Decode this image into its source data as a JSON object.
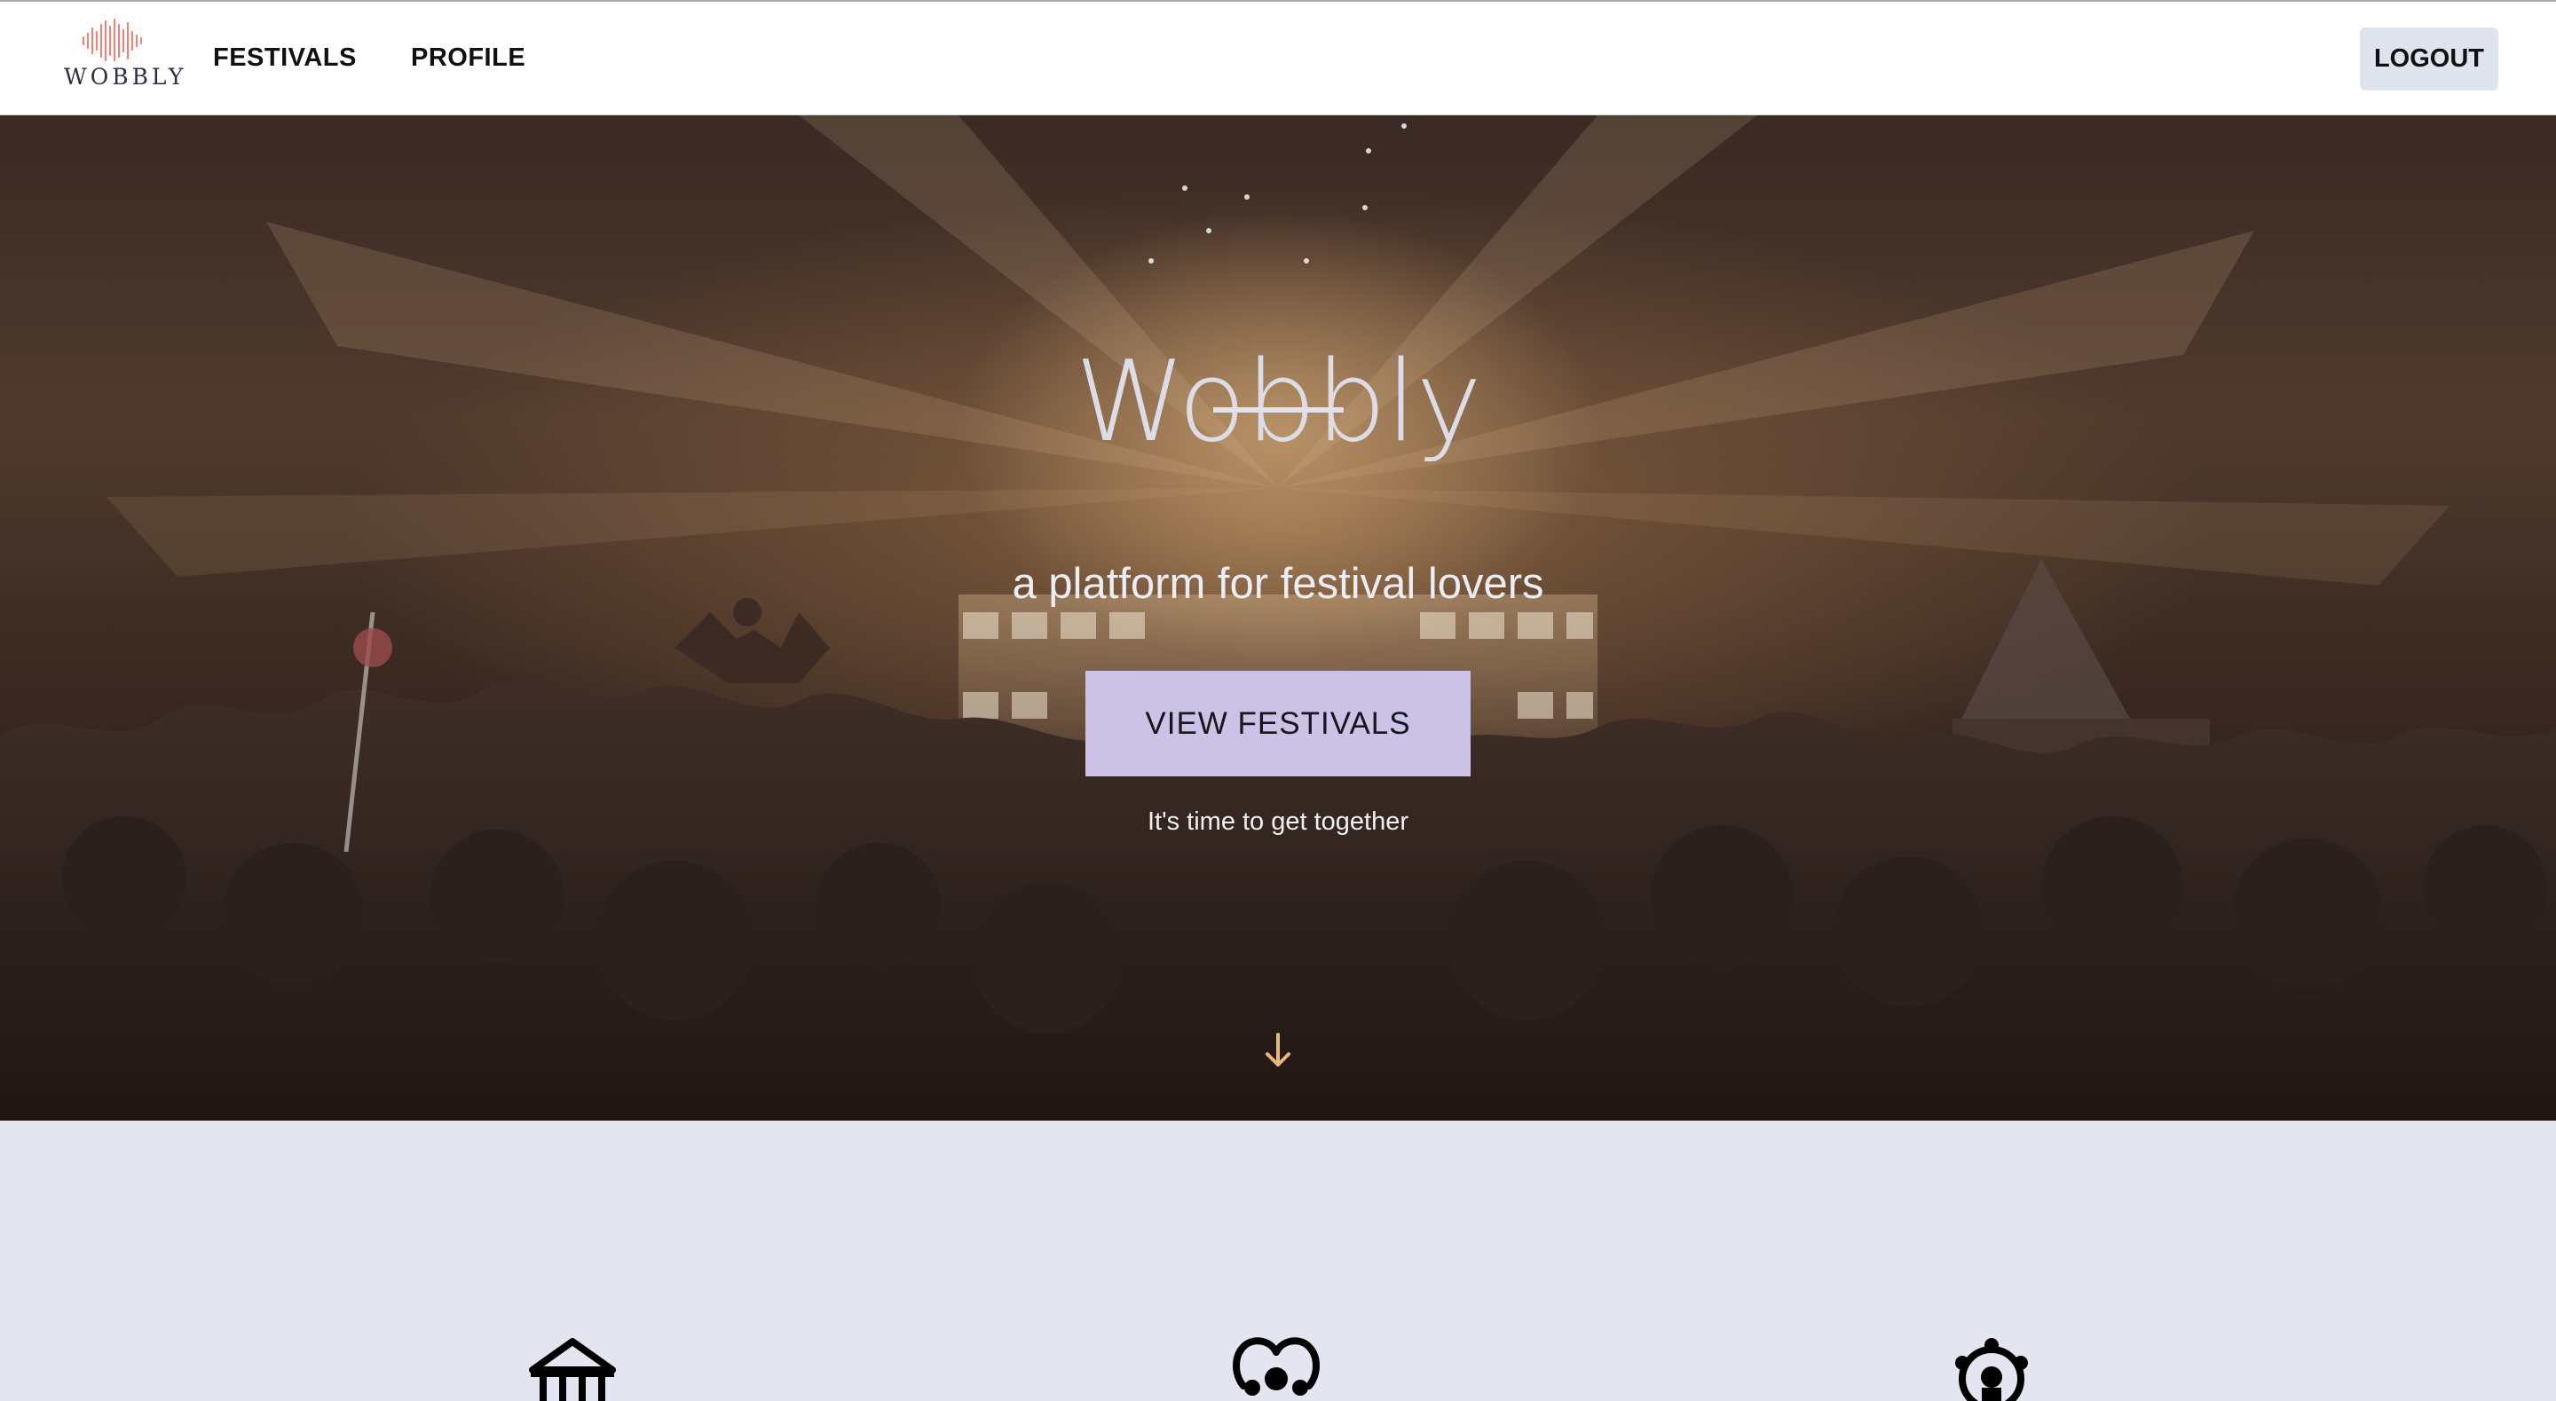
{
  "navbar": {
    "logo_text": "WOBBLY",
    "links": [
      {
        "label": "FESTIVALS"
      },
      {
        "label": "PROFILE"
      }
    ],
    "logout_label": "LOGOUT"
  },
  "hero": {
    "title": "Wobbly",
    "tagline": "a platform for festival lovers",
    "cta_label": "VIEW FESTIVALS",
    "subtext": "It's time to get together",
    "scroll_icon": "arrow-down-icon"
  },
  "features": {
    "icons": [
      "carousel-icon",
      "group-heart-icon",
      "ferris-wheel-icon"
    ]
  },
  "colors": {
    "nav_bg": "#ffffff",
    "logout_bg": "#dfe3ee",
    "cta_bg": "#ccc2e5",
    "feature_bg": "#e3e6f1",
    "logo_accent": "#e08a7d",
    "arrow": "#e8b87a"
  }
}
